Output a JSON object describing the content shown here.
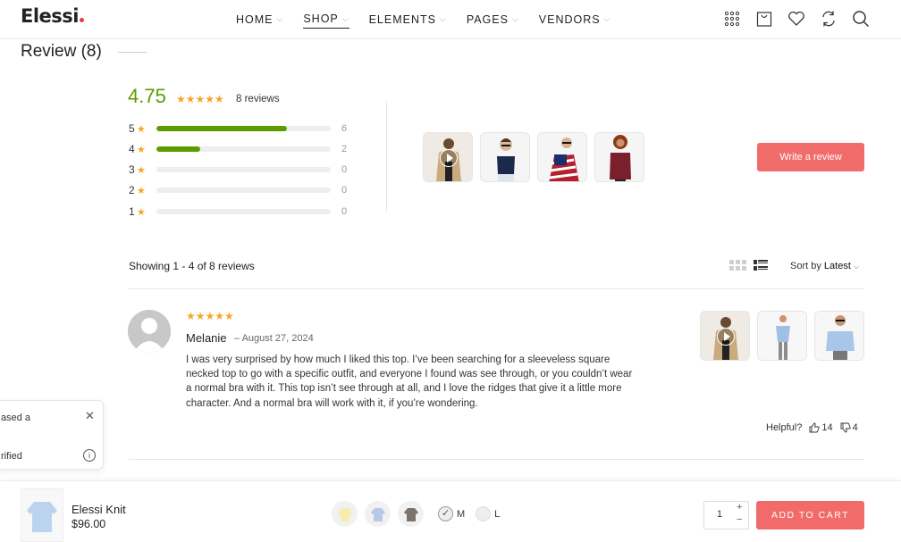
{
  "brand": {
    "name": "Elessi",
    "dot_color": "#e8384f"
  },
  "nav": [
    {
      "label": "HOME",
      "active": false
    },
    {
      "label": "SHOP",
      "active": true
    },
    {
      "label": "ELEMENTS",
      "active": false
    },
    {
      "label": "PAGES",
      "active": false
    },
    {
      "label": "VENDORS",
      "active": false
    }
  ],
  "header_icons": [
    "grid-icon",
    "bag-icon",
    "heart-icon",
    "compare-icon",
    "search-icon"
  ],
  "reviews": {
    "title": "Review (8)",
    "average": "4.75",
    "stars": "★★★★★",
    "count_label": "8 reviews",
    "accent": "#5d9c00",
    "star_color": "#f5a623",
    "distribution": [
      {
        "stars": "5",
        "count": "6",
        "fraction": 0.75
      },
      {
        "stars": "4",
        "count": "2",
        "fraction": 0.25
      },
      {
        "stars": "3",
        "count": "0",
        "fraction": 0
      },
      {
        "stars": "2",
        "count": "0",
        "fraction": 0
      },
      {
        "stars": "1",
        "count": "0",
        "fraction": 0
      }
    ],
    "write_label": "Write a review",
    "showing": "Showing 1 - 4 of 8 reviews",
    "sort_prefix": "Sort by",
    "sort_value": "Latest"
  },
  "review_item": {
    "stars": "★★★★★",
    "name": "Melanie",
    "date": "– August 27, 2024",
    "text": "I was very surprised by how much I liked this top. I’ve been searching for a sleeveless square necked top to go with a specific outfit, and everyone I found was see through, or you couldn’t wear a normal bra with it. This top isn’t see through at all, and I love the ridges that give it a little more character. And a normal bra will work with it, if you’re wondering.",
    "helpful_label": "Helpful?",
    "likes": "14",
    "dislikes": "4"
  },
  "popup": {
    "text1": "ased a",
    "text2": "rified"
  },
  "sticky": {
    "product_name": "Elessi Knit",
    "price": "$96.00",
    "sizes": [
      {
        "label": "M",
        "selected": true
      },
      {
        "label": "L",
        "selected": false
      }
    ],
    "quantity": "1",
    "cart_label": "ADD TO CART",
    "button_color": "#f26b6b"
  }
}
